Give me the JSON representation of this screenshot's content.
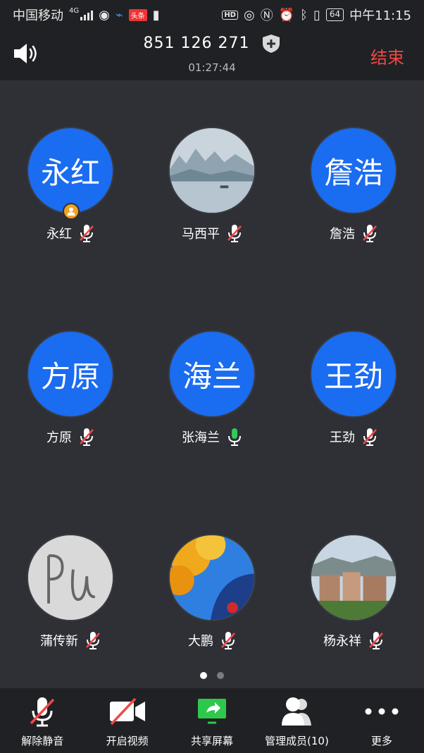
{
  "status_bar": {
    "carrier": "中国移动",
    "network": "4G",
    "news_app_badge": "头条",
    "battery": "64",
    "time": "中午11:15"
  },
  "header": {
    "meeting_id": "851 126 271",
    "timer": "01:27:44",
    "end_label": "结束"
  },
  "participants": [
    {
      "name": "永红",
      "avatar_text": "永红",
      "avatar_type": "text",
      "muted": true,
      "host": true
    },
    {
      "name": "马西平",
      "avatar_text": "",
      "avatar_type": "photo-lake",
      "muted": true,
      "host": false
    },
    {
      "name": "詹浩",
      "avatar_text": "詹浩",
      "avatar_type": "text",
      "muted": true,
      "host": false
    },
    {
      "name": "方原",
      "avatar_text": "方原",
      "avatar_type": "text",
      "muted": true,
      "host": false
    },
    {
      "name": "张海兰",
      "avatar_text": "海兰",
      "avatar_type": "text",
      "muted": false,
      "host": false
    },
    {
      "name": "王劲",
      "avatar_text": "王劲",
      "avatar_type": "text",
      "muted": true,
      "host": false
    },
    {
      "name": "蒲传新",
      "avatar_text": "",
      "avatar_type": "photo-handwriting",
      "muted": true,
      "host": false
    },
    {
      "name": "大鹏",
      "avatar_text": "",
      "avatar_type": "photo-autumn",
      "muted": true,
      "host": false
    },
    {
      "name": "杨永祥",
      "avatar_text": "",
      "avatar_type": "photo-town",
      "muted": true,
      "host": false
    }
  ],
  "pagination": {
    "pages": 2,
    "current": 1
  },
  "toolbar": {
    "unmute_label": "解除静音",
    "video_label": "开启视频",
    "share_label": "共享屏幕",
    "members_label": "管理成员(10)",
    "more_label": "更多"
  },
  "colors": {
    "avatar_blue": "#1a6cf0",
    "end_red": "#f04848",
    "mic_active_green": "#34c759",
    "host_badge": "#f3a21c",
    "share_green": "#2ec84c"
  }
}
